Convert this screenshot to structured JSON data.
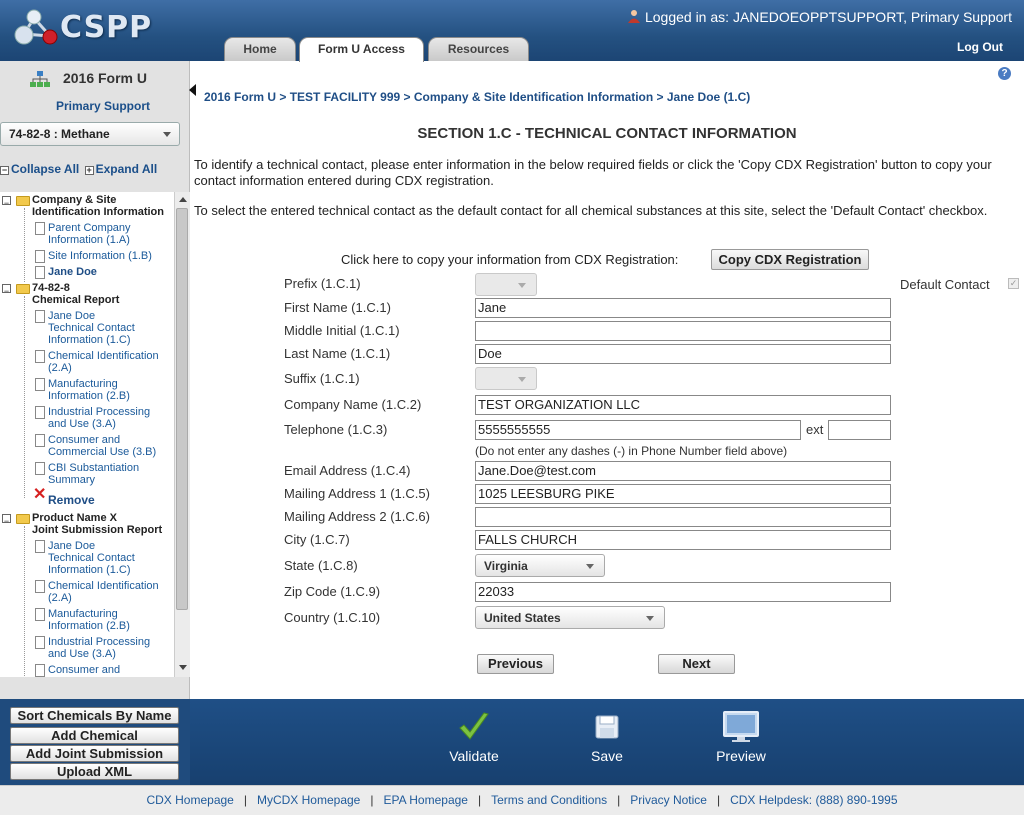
{
  "header": {
    "logo_text": "CSPP",
    "login_prefix": "Logged in as:",
    "login_user": "JANEDOEOPPTSUPPORT",
    "login_role": "Primary Support",
    "logout": "Log Out",
    "tabs": [
      {
        "label": "Home",
        "active": false
      },
      {
        "label": "Form U Access",
        "active": true
      },
      {
        "label": "Resources",
        "active": false
      }
    ]
  },
  "sidebar": {
    "title": "2016 Form U",
    "subtitle": "Primary Support",
    "chemical_select": "74-82-8 : Methane",
    "collapse_all": "Collapse All",
    "expand_all": "Expand All",
    "tree": {
      "group1": {
        "line1": "Company & Site",
        "line2": "Identification Information"
      },
      "g1_items": [
        {
          "l1": "Parent Company",
          "l2": "Information (1.A)"
        },
        {
          "l1": "Site Information (1.B)"
        },
        {
          "l1": "Jane Doe"
        }
      ],
      "group2": {
        "line1": "74-82-8",
        "line2": "Chemical Report"
      },
      "g2_items": [
        {
          "l1": "Jane Doe",
          "l2": "Technical Contact",
          "l3": "Information (1.C)"
        },
        {
          "l1": "Chemical Identification",
          "l2": "(2.A)"
        },
        {
          "l1": "Manufacturing",
          "l2": "Information (2.B)"
        },
        {
          "l1": "Industrial Processing",
          "l2": "and Use (3.A)"
        },
        {
          "l1": "Consumer and",
          "l2": "Commercial Use (3.B)"
        },
        {
          "l1": "CBI Substantiation",
          "l2": "Summary"
        }
      ],
      "remove": "Remove",
      "group3": {
        "line1": "Product Name X",
        "line2": "Joint Submission Report"
      },
      "g3_items": [
        {
          "l1": "Jane Doe",
          "l2": "Technical Contact",
          "l3": "Information (1.C)"
        },
        {
          "l1": "Chemical Identification",
          "l2": "(2.A)"
        },
        {
          "l1": "Manufacturing",
          "l2": "Information (2.B)"
        },
        {
          "l1": "Industrial Processing",
          "l2": "and Use (3.A)"
        },
        {
          "l1": "Consumer and"
        }
      ]
    },
    "buttons": [
      "Sort Chemicals By Name",
      "Add Chemical",
      "Add Joint Submission",
      "Upload XML"
    ]
  },
  "main": {
    "breadcrumb": "2016 Form U > TEST FACILITY 999 > Company & Site Identification Information > Jane Doe (1.C)",
    "section_title": "SECTION 1.C - TECHNICAL CONTACT INFORMATION",
    "para1": "To identify a technical contact, please enter information in the below required fields or click the 'Copy CDX Registration' button to copy your contact information entered during CDX registration.",
    "para2": "To select the entered technical contact as the default contact for all chemical substances at this site, select the 'Default Contact' checkbox.",
    "copy_text": "Click here to copy your information from CDX Registration:",
    "copy_button": "Copy CDX Registration",
    "default_contact": "Default Contact",
    "form": {
      "prefix_label": "Prefix (1.C.1)",
      "first_name_label": "First Name (1.C.1)",
      "first_name": "Jane",
      "middle_label": "Middle Initial (1.C.1)",
      "middle": "",
      "last_name_label": "Last Name (1.C.1)",
      "last_name": "Doe",
      "suffix_label": "Suffix (1.C.1)",
      "company_label": "Company Name (1.C.2)",
      "company": "TEST ORGANIZATION LLC",
      "telephone_label": "Telephone (1.C.3)",
      "telephone": "5555555555",
      "ext_label": "ext",
      "ext": "",
      "phone_hint": "(Do not enter any dashes (-) in Phone Number field above)",
      "email_label": "Email Address (1.C.4)",
      "email": "Jane.Doe@test.com",
      "address1_label": "Mailing Address 1 (1.C.5)",
      "address1": "1025 LEESBURG PIKE",
      "address2_label": "Mailing Address 2 (1.C.6)",
      "address2": "",
      "city_label": "City (1.C.7)",
      "city": "FALLS CHURCH",
      "state_label": "State (1.C.8)",
      "state": "Virginia",
      "zip_label": "Zip Code (1.C.9)",
      "zip": "22033",
      "country_label": "Country (1.C.10)",
      "country": "United States"
    },
    "previous": "Previous",
    "next": "Next"
  },
  "actions": {
    "validate": "Validate",
    "save": "Save",
    "preview": "Preview"
  },
  "footer": {
    "links": [
      "CDX Homepage",
      "MyCDX Homepage",
      "EPA Homepage",
      "Terms and Conditions",
      "Privacy Notice",
      "CDX Helpdesk: (888) 890-1995"
    ]
  },
  "colors": {
    "header_blue": "#245181",
    "link_blue": "#1b5a9a",
    "validate_green": "#7cc242",
    "remove_red": "#d62020"
  }
}
